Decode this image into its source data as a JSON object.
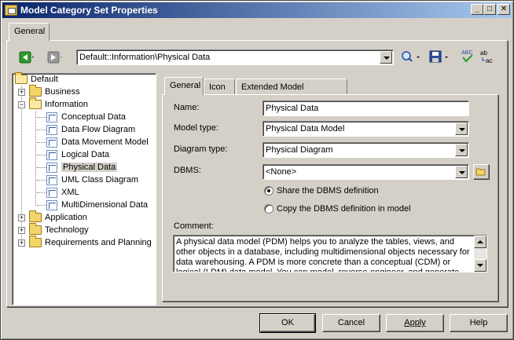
{
  "window": {
    "title": "Model Category Set Properties"
  },
  "outer_tabs": [
    {
      "label": "General"
    }
  ],
  "toolbar": {
    "path_value": "Default::Information\\Physical Data"
  },
  "tree": {
    "root": "Default",
    "items": [
      {
        "label": "Business",
        "type": "folder",
        "expander": "+"
      },
      {
        "label": "Information",
        "type": "folder",
        "expander": "−"
      },
      {
        "label": "Conceptual Data",
        "type": "diagram"
      },
      {
        "label": "Data Flow Diagram",
        "type": "diagram"
      },
      {
        "label": "Data Movement Model",
        "type": "diagram"
      },
      {
        "label": "Logical Data",
        "type": "diagram"
      },
      {
        "label": "Physical Data",
        "type": "diagram",
        "selected": true
      },
      {
        "label": "UML Class Diagram",
        "type": "diagram"
      },
      {
        "label": "XML",
        "type": "diagram"
      },
      {
        "label": "MultiDimensional Data",
        "type": "diagram"
      },
      {
        "label": "Application",
        "type": "folder",
        "expander": "+"
      },
      {
        "label": "Technology",
        "type": "folder",
        "expander": "+"
      },
      {
        "label": "Requirements and Planning",
        "type": "folder",
        "expander": "+"
      }
    ]
  },
  "inner_tabs": [
    {
      "label": "General"
    },
    {
      "label": "Icon"
    },
    {
      "label": "Extended Model Definitions"
    }
  ],
  "form": {
    "name_label": "Name:",
    "name_value": "Physical Data",
    "model_type_label": "Model type:",
    "model_type_value": "Physical Data Model",
    "diagram_type_label": "Diagram type:",
    "diagram_type_value": "Physical Diagram",
    "dbms_label": "DBMS:",
    "dbms_value": "<None>",
    "radio_share": "Share the DBMS definition",
    "radio_copy": "Copy the DBMS definition in model",
    "comment_label": "Comment:",
    "comment_text": "A physical data model (PDM) helps you to analyze the tables, views, and other objects in a database, including multidimensional objects necessary for data warehousing. A PDM is more concrete than a conceptual (CDM) or logical (LDM) data model. You can model, reverse-engineer, and generate for all the most popular DBMSs."
  },
  "buttons": {
    "ok": "OK",
    "cancel": "Cancel",
    "apply": "Apply",
    "help": "Help"
  },
  "colors": {
    "titlebar_start": "#0a246a",
    "titlebar_end": "#a6caf0",
    "face": "#d4d0c8"
  }
}
